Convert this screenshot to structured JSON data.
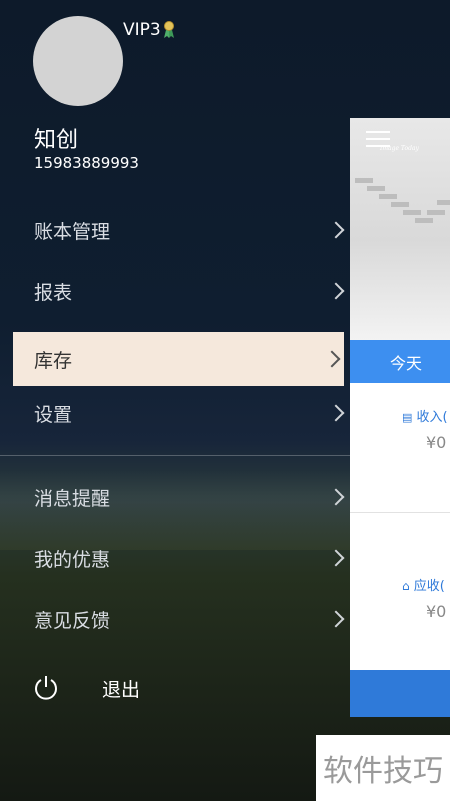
{
  "user": {
    "vip_label": "VIP3",
    "name": "知创",
    "phone": "15983889993"
  },
  "menu": {
    "items": [
      {
        "label": "账本管理",
        "active": false
      },
      {
        "label": "报表",
        "active": false
      },
      {
        "label": "库存",
        "active": true
      },
      {
        "label": "设置",
        "active": false
      },
      {
        "label": "消息提醒",
        "active": false
      },
      {
        "label": "我的优惠",
        "active": false
      },
      {
        "label": "意见反馈",
        "active": false
      }
    ],
    "logout_label": "退出"
  },
  "main": {
    "banner_brand": "Image Today",
    "tab_today": "今天",
    "income_label": "收入(",
    "income_amount": "¥0",
    "receivable_label": "应收(",
    "receivable_amount": "¥0"
  },
  "watermark": "软件技巧",
  "colors": {
    "accent": "#3d8ff0",
    "active_item_bg": "#f5e8dc",
    "avatar": "#d3d3d3"
  }
}
